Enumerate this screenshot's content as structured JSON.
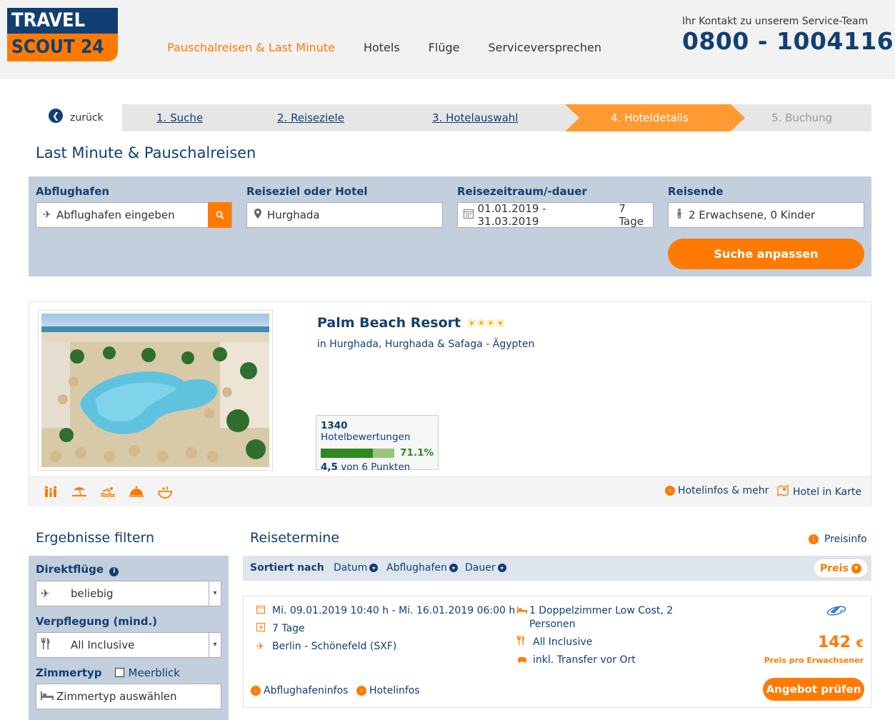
{
  "header": {
    "logo_top": "TRAVEL",
    "logo_bottom": "SCOUT 24",
    "nav": [
      {
        "label": "Pauschalreisen & Last Minute",
        "active": true
      },
      {
        "label": "Hotels",
        "active": false
      },
      {
        "label": "Flüge",
        "active": false
      },
      {
        "label": "Serviceversprechen",
        "active": false
      }
    ],
    "contact_label": "Ihr Kontakt zu unserem Service-Team",
    "contact_phone": "0800 - 1004116"
  },
  "steps": {
    "back": "zurück",
    "items": [
      "1. Suche",
      "2. Reiseziele",
      "3. Hotelauswahl",
      "4. Hoteldetails",
      "5. Buchung"
    ],
    "current": 3
  },
  "page_title": "Last Minute & Pauschalreisen",
  "search": {
    "departure": {
      "label": "Abflughafen",
      "placeholder": "Abflughafen eingeben",
      "icon": "plane-icon"
    },
    "destination": {
      "label": "Reiseziel oder Hotel",
      "value": "Hurghada",
      "icon": "location-pin-icon"
    },
    "period": {
      "label": "Reisezeitraum/-dauer",
      "value": "01.01.2019 - 31.03.2019",
      "duration": "7 Tage",
      "icon": "calendar-icon"
    },
    "travelers": {
      "label": "Reisende",
      "value": "2 Erwachsene, 0 Kinder",
      "icon": "person-icon"
    },
    "submit": "Suche anpassen"
  },
  "hotel": {
    "name": "Palm Beach Resort",
    "stars": 4,
    "location": "in Hurghada, Hurghada & Safaga - Ägypten",
    "reviews_count": "1340",
    "reviews_label": "Hotelbewertungen",
    "recommend_pct": "71.1%",
    "recommend_value": 0.711,
    "score": "4,5",
    "score_label": "von 6 Punkten",
    "amenities": [
      "family-icon",
      "beach-icon",
      "swimming-icon",
      "restaurant-icon",
      "spa-icon"
    ],
    "link_info": "Hotelinfos & mehr",
    "link_map": "Hotel in Karte"
  },
  "filter": {
    "title": "Ergebnisse filtern",
    "direct_label": "Direktflüge",
    "direct_value": "beliebig",
    "board_label": "Verpflegung (mind.)",
    "board_value": "All Inclusive",
    "room_label": "Zimmertyp",
    "seaview_label": "Meerblick",
    "room_placeholder": "Zimmertyp auswählen"
  },
  "results": {
    "title": "Reisetermine",
    "price_info": "Preisinfo",
    "sort_label": "Sortiert nach",
    "sort_options": [
      "Datum",
      "Abflughafen",
      "Dauer"
    ],
    "sort_active": "Preis",
    "offer": {
      "dates": "Mi. 09.01.2019 10:40 h - Mi. 16.01.2019 06:00 h",
      "duration": "7 Tage",
      "route": "Berlin - Schönefeld (SXF)",
      "room": "1 Doppelzimmer Low Cost, 2 Personen",
      "board": "All Inclusive",
      "transfer": "inkl. Transfer vor Ort",
      "price": "142",
      "currency": "€",
      "price_note": "Preis pro Erwachsener",
      "link_airport": "Abflughafeninfos",
      "link_hotel": "Hotelinfos",
      "cta": "Angebot prüfen"
    }
  },
  "colors": {
    "brand_navy": "#123f73",
    "brand_orange": "#ff7a00",
    "panel": "#c3cfdc"
  }
}
